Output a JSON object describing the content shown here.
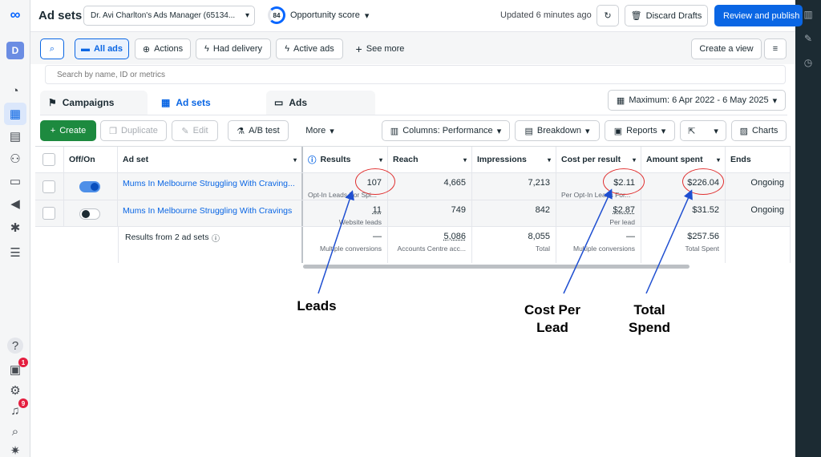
{
  "app": {
    "title": "Ad sets",
    "account": "Dr. Avi Charlton's Ads Manager (65134...",
    "opportunity_score": "84",
    "opportunity_label": "Opportunity score",
    "updated": "Updated 6 minutes ago"
  },
  "header_buttons": {
    "discard": "Discard Drafts",
    "review": "Review and publish"
  },
  "filters": {
    "all_ads": "All ads",
    "actions": "Actions",
    "had_delivery": "Had delivery",
    "active_ads": "Active ads",
    "see_more": "See more",
    "create_view": "Create a view"
  },
  "search": {
    "placeholder": "Search by name, ID or metrics"
  },
  "tabs": {
    "campaigns": "Campaigns",
    "ad_sets": "Ad sets",
    "ads": "Ads"
  },
  "date_range": "Maximum: 6 Apr 2022 - 6 May 2025",
  "toolbar": {
    "create": "Create",
    "duplicate": "Duplicate",
    "edit": "Edit",
    "ab_test": "A/B test",
    "more": "More",
    "columns": "Columns: Performance",
    "breakdown": "Breakdown",
    "reports": "Reports",
    "charts": "Charts"
  },
  "table": {
    "headers": {
      "offon": "Off/On",
      "adset": "Ad set",
      "results": "Results",
      "reach": "Reach",
      "impressions": "Impressions",
      "cpr": "Cost per result",
      "spent": "Amount spent",
      "ends": "Ends"
    },
    "rows": [
      {
        "name": "Mums In Melbourne Struggling With Craving...",
        "results": "107",
        "results_sub": "Opt-In Leads For Spi...",
        "reach": "4,665",
        "impressions": "7,213",
        "cpr": "$2.11",
        "cpr_sub": "Per Opt-In Leads For...",
        "spent": "$226.04",
        "ends": "Ongoing"
      },
      {
        "name": "Mums In Melbourne Struggling With Cravings",
        "results": "11",
        "results_sub": "Website leads",
        "reach": "749",
        "impressions": "842",
        "cpr": "$2.87",
        "cpr_sub": "Per lead",
        "spent": "$31.52",
        "ends": "Ongoing"
      }
    ],
    "summary": {
      "label": "Results from 2 ad sets",
      "results": "—",
      "results_sub": "Multiple conversions",
      "reach": "5,086",
      "reach_sub": "Accounts Centre acc...",
      "impressions": "8,055",
      "impressions_sub": "Total",
      "cpr": "—",
      "cpr_sub": "Multiple conversions",
      "spent": "$257.56",
      "spent_sub": "Total Spent"
    }
  },
  "annotations": {
    "leads": "Leads",
    "cpl_1": "Cost Per",
    "cpl_2": "Lead",
    "spend_1": "Total",
    "spend_2": "Spend"
  },
  "colors": {
    "accent": "#0a66e4",
    "create": "#1d8a3f",
    "annotation": "#e03131",
    "arrow": "#1f4fd1"
  },
  "rail_badges": {
    "notifications": "1",
    "alerts": "9"
  }
}
